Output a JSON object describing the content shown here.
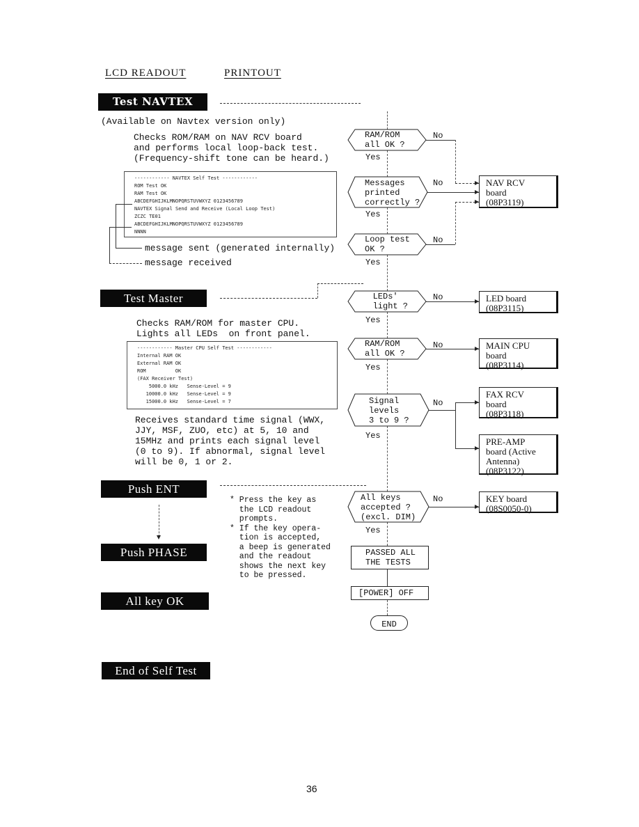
{
  "headers": {
    "lcd": "LCD READOUT",
    "printout": "PRINTOUT"
  },
  "sections": {
    "navtex": {
      "lcd": "Test NAVTEX",
      "availability": "(Available on Navtex version only)",
      "description": "Checks ROM/RAM on NAV RCV board\nand performs local loop-back test.\n(Frequency-shift tone can be heard.)",
      "printout": [
        "------------ NAVTEX Self Test ------------",
        "ROM Test OK",
        "RAM Test OK",
        "ABCDEFGHIJKLMNOPQRSTUVWXYZ 0123456789",
        "NAVTEX Signal Send and Receive (Local Loop Test)",
        "ZCZC TE01",
        "ABCDEFGHIJKLMNOPQRSTUVWXYZ 0123456789",
        "NNNN"
      ],
      "legend_sent": "message sent (generated internally)",
      "legend_received": "message received"
    },
    "master": {
      "lcd": "Test Master",
      "description": "Checks RAM/ROM for master CPU.\nLights all LEDs  on front panel.",
      "printout": [
        "------------ Master CPU Self Test ------------",
        "Internal RAM OK",
        "External RAM OK",
        "ROM          OK",
        "(FAX Receiver Test)",
        "    5000.0 kHz   Sense-Level = 9",
        "   10000.0 kHz   Sense-Level = 9",
        "   15000.0 kHz   Sense-Level = 7"
      ],
      "fax_description": "Receives standard time signal (WWX,\nJJY, MSF, ZUO, etc) at 5, 10 and\n15MHz and prints each signal level\n(0 to 9). If abnormal, signal level\nwill be 0, 1 or 2."
    },
    "keys": {
      "push_ent": "Push  ENT",
      "push_phase": "Push  PHASE",
      "all_key_ok": "All key OK",
      "notes": "* Press the key as\n  the LCD readout\n  prompts.\n* If the key opera-\n  tion is accepted,\n  a beep is generated\n  and the readout\n  shows the next key\n  to be pressed."
    },
    "end": {
      "lcd": "End of Self Test"
    }
  },
  "flowchart": {
    "yes": "Yes",
    "no": "No",
    "decisions": [
      {
        "id": "ram-rom-nav",
        "text": "RAM/ROM\nall OK ?"
      },
      {
        "id": "messages-printed",
        "text": "Messages\nprinted\ncorrectly ?"
      },
      {
        "id": "loop-test",
        "text": "Loop test\nOK ?"
      },
      {
        "id": "leds-light",
        "text": "   LEDs'\n   light ?"
      },
      {
        "id": "ram-rom-main",
        "text": "RAM/ROM\nall OK ?"
      },
      {
        "id": "signal-levels",
        "text": "Signal\nlevels\n3 to 9 ?"
      },
      {
        "id": "all-keys",
        "text": "All keys\naccepted ?\n(excl. DIM)"
      }
    ],
    "boards": [
      {
        "id": "nav-rcv",
        "text": "NAV RCV\nboard\n(08P3119)"
      },
      {
        "id": "led",
        "text": "LED board\n(08P3115)"
      },
      {
        "id": "main-cpu",
        "text": "MAIN CPU\nboard\n(08P3114)"
      },
      {
        "id": "fax-rcv",
        "text": "FAX RCV\nboard\n(08P3118)"
      },
      {
        "id": "pre-amp",
        "text": "PRE-AMP\nboard (Active\nAntenna)\n(08P3122)"
      },
      {
        "id": "key",
        "text": "KEY board\n(08S0050-0)"
      }
    ],
    "passed": "PASSED ALL\nTHE TESTS",
    "power_off": "[POWER] OFF",
    "end": "END"
  },
  "page_number": "36"
}
